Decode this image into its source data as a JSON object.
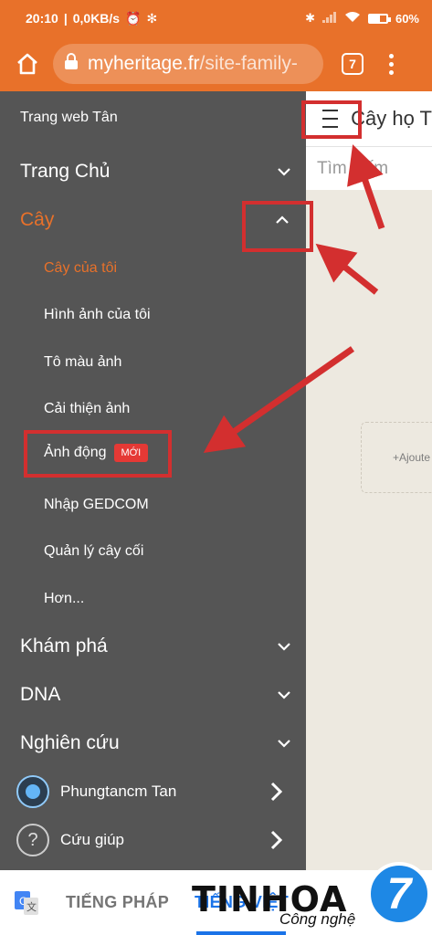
{
  "status": {
    "time": "20:10",
    "speed": "0,0KB/s",
    "battery": "60%",
    "battery_level": 0.6
  },
  "browser": {
    "url_host": "myheritage.fr",
    "url_path": "/site-family-",
    "tab_count": "7"
  },
  "sidebar": {
    "site_name": "Trang web Tân",
    "items": [
      {
        "label": "Trang Chủ"
      },
      {
        "label": "Cây"
      },
      {
        "label": "Khám phá"
      },
      {
        "label": "DNA"
      },
      {
        "label": "Nghiên cứu"
      }
    ],
    "sub_items": [
      {
        "label": "Cây của tôi"
      },
      {
        "label": "Hình ảnh của tôi"
      },
      {
        "label": "Tô màu ảnh"
      },
      {
        "label": "Cải thiện ảnh"
      },
      {
        "label": "Ảnh động",
        "badge": "MỚI"
      },
      {
        "label": "Nhập GEDCOM"
      },
      {
        "label": "Quản lý cây cối"
      },
      {
        "label": "Hơn..."
      }
    ],
    "profile_name": "Phungtancm Tan",
    "help_label": "Cứu giúp"
  },
  "content": {
    "title": "Cây họ T",
    "search_placeholder": "Tìm kiếm",
    "add_label": "+Ajoute"
  },
  "translate": {
    "lang_source": "TIẾNG PHÁP",
    "lang_target": "TIẾNG VIỆT"
  },
  "watermark": {
    "brand": "TINHOA",
    "tagline": "Công nghệ",
    "badge": "7"
  },
  "colors": {
    "accent": "#e8712a",
    "sidebar_bg": "#555555",
    "highlight": "#d32f2f",
    "badge_new": "#e53935",
    "translate_active": "#1a73e8"
  }
}
